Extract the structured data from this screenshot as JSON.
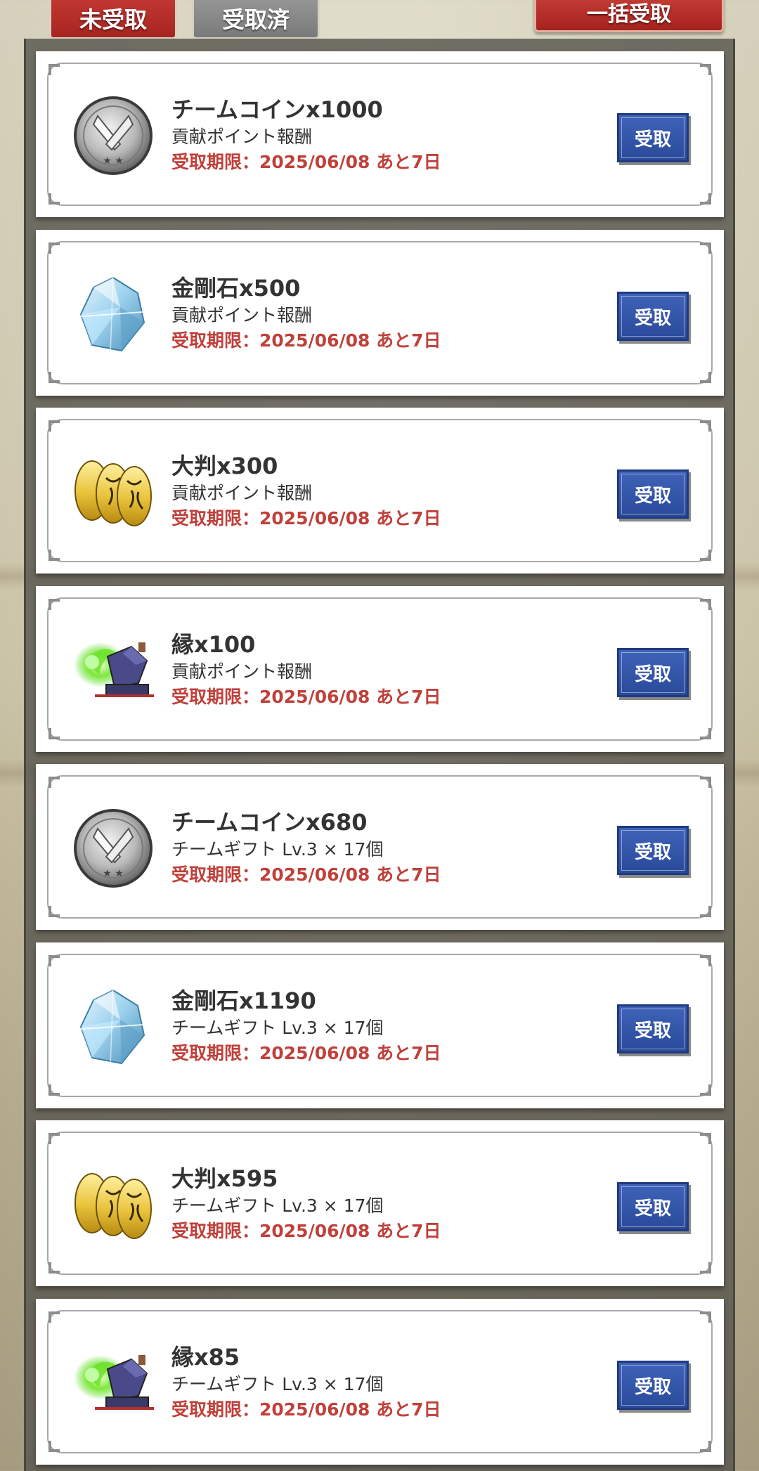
{
  "tabs": {
    "unreceived": "未受取",
    "received": "受取済"
  },
  "bulk_receive_label": "一括受取",
  "receive_label": "受取",
  "items": [
    {
      "icon": "team-coin-icon",
      "title": "チームコインx1000",
      "source": "貢献ポイント報酬",
      "deadline": "受取期限：2025/06/08 あと7日"
    },
    {
      "icon": "diamond-stone-icon",
      "title": "金剛石x500",
      "source": "貢献ポイント報酬",
      "deadline": "受取期限：2025/06/08 あと7日"
    },
    {
      "icon": "gold-oban-icon",
      "title": "大判x300",
      "source": "貢献ポイント報酬",
      "deadline": "受取期限：2025/06/08 あと7日"
    },
    {
      "icon": "en-bond-icon",
      "title": "縁x100",
      "source": "貢献ポイント報酬",
      "deadline": "受取期限：2025/06/08 あと7日"
    },
    {
      "icon": "team-coin-icon",
      "title": "チームコインx680",
      "source": "チームギフト Lv.3 × 17個",
      "deadline": "受取期限：2025/06/08 あと7日"
    },
    {
      "icon": "diamond-stone-icon",
      "title": "金剛石x1190",
      "source": "チームギフト Lv.3 × 17個",
      "deadline": "受取期限：2025/06/08 あと7日"
    },
    {
      "icon": "gold-oban-icon",
      "title": "大判x595",
      "source": "チームギフト Lv.3 × 17個",
      "deadline": "受取期限：2025/06/08 あと7日"
    },
    {
      "icon": "en-bond-icon",
      "title": "縁x85",
      "source": "チームギフト Lv.3 × 17個",
      "deadline": "受取期限：2025/06/08 あと7日"
    }
  ]
}
